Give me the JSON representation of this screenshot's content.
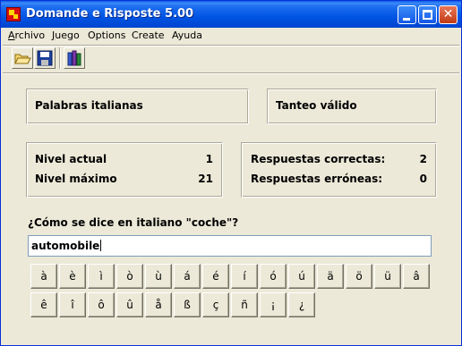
{
  "window": {
    "title": "Domande e Risposte 5.00"
  },
  "menu": [
    {
      "label": "Archivo",
      "underline": "A",
      "rest": "rchivo"
    },
    {
      "label": "Juego",
      "underline": "J",
      "rest": "uego"
    },
    {
      "label": "Options",
      "underline": "",
      "rest": "Options"
    },
    {
      "label": "Create",
      "underline": "",
      "rest": "Create"
    },
    {
      "label": "Ayuda",
      "underline": "",
      "rest": "Ayuda"
    }
  ],
  "toolbar": {
    "icons": [
      "folder-open-icon",
      "save-disk-icon",
      "bookshelf-icon"
    ]
  },
  "panels": {
    "topic": "Palabras italianas",
    "scoring": "Tanteo válido",
    "level_current_label": "Nivel actual",
    "level_current_value": "1",
    "level_max_label": "Nivel máximo",
    "level_max_value": "21",
    "correct_label": "Respuestas correctas:",
    "correct_value": "2",
    "wrong_label": "Respuestas erróneas:",
    "wrong_value": "0"
  },
  "question": "¿Cómo se dice en italiano \"coche\"?",
  "answer": "automobile",
  "chars_row1": [
    "à",
    "è",
    "ì",
    "ò",
    "ù",
    "á",
    "é",
    "í",
    "ó",
    "ú",
    "ä",
    "ö",
    "ü",
    "â"
  ],
  "chars_row2": [
    "ê",
    "î",
    "ô",
    "û",
    "å",
    "ß",
    "ç",
    "ñ",
    "¡",
    "¿"
  ]
}
